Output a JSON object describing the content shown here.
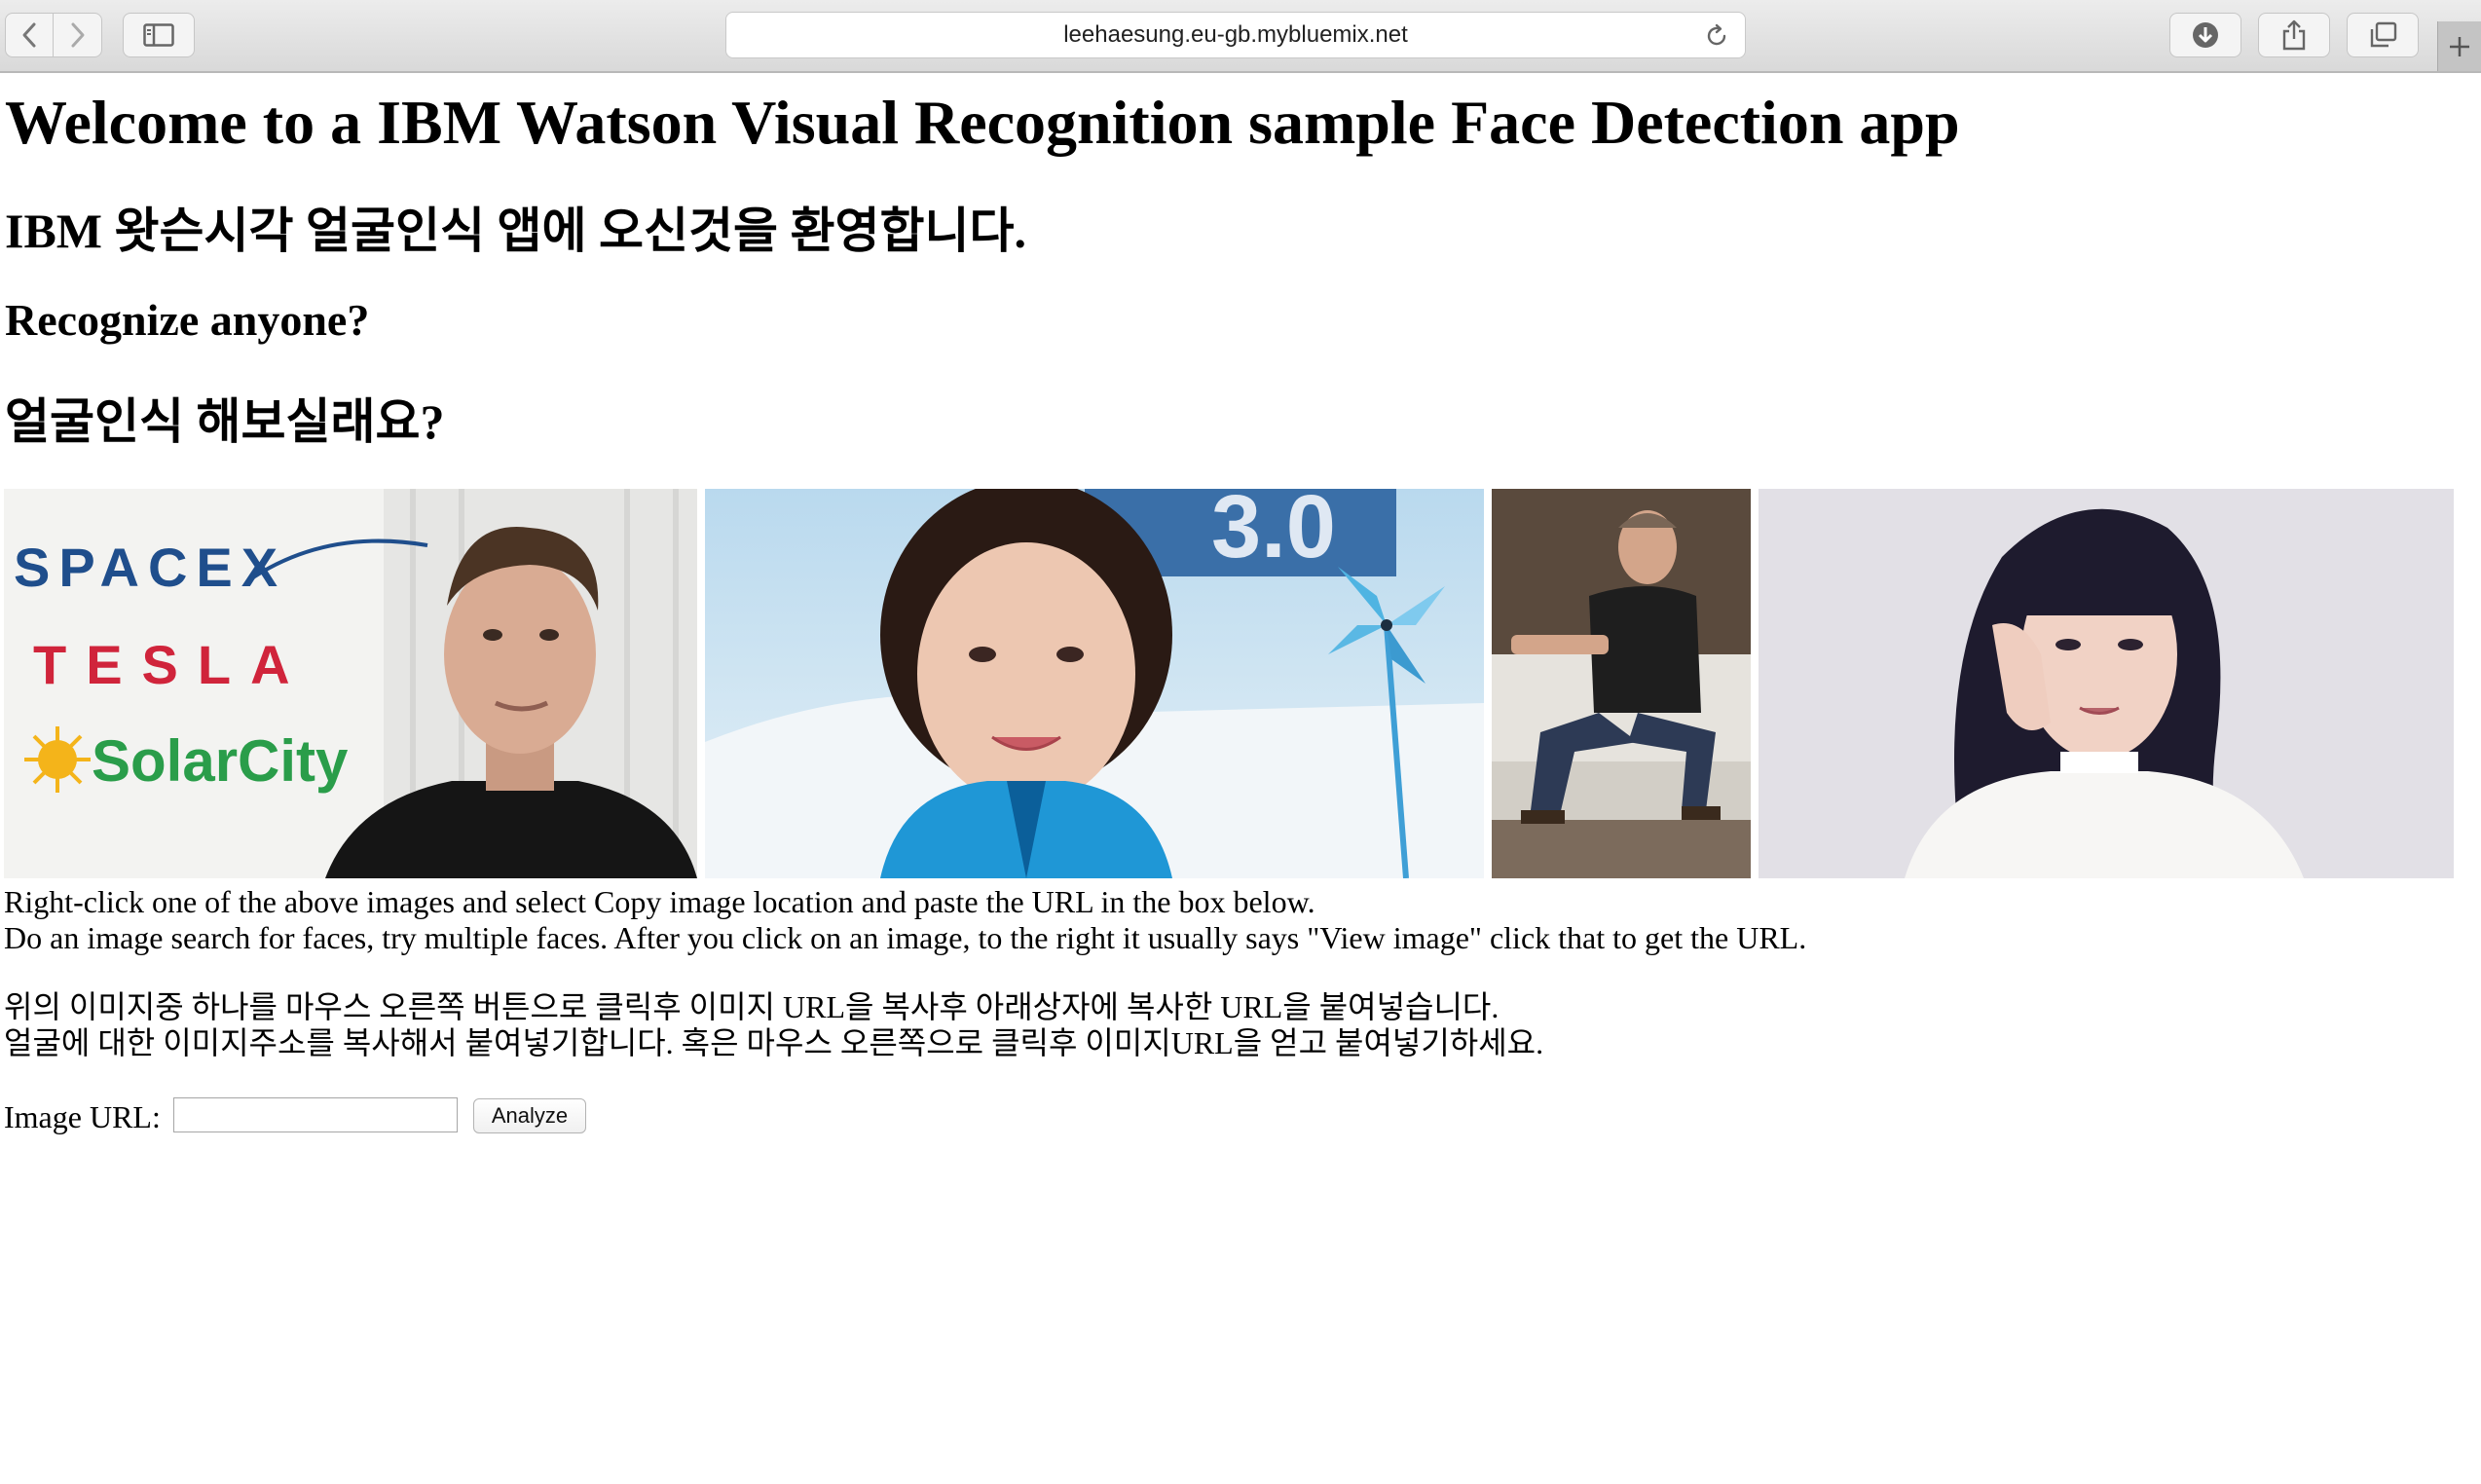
{
  "browser": {
    "url": "leehaesung.eu-gb.mybluemix.net",
    "icons": {
      "back": "chevron-left-icon",
      "forward": "chevron-right-icon",
      "sidebar": "sidebar-icon",
      "reload": "reload-icon",
      "downloads": "download-icon",
      "share": "share-icon",
      "tabs": "tabs-overview-icon",
      "new_tab": "plus-icon"
    }
  },
  "page": {
    "title": "Welcome to a IBM Watson Visual Recognition sample Face Detection app",
    "title_ko": "IBM 왓슨시각 얼굴인식 앱에 오신것을 환영합니다.",
    "prompt": "Recognize anyone?",
    "prompt_ko": "얼굴인식 해보실래요?",
    "images": [
      {
        "name": "elon-musk-photo",
        "logos": [
          "SPACEX",
          "TESLA",
          "SolarCity"
        ]
      },
      {
        "name": "skater-photo",
        "sign_text": "3.0"
      },
      {
        "name": "linus-photo"
      },
      {
        "name": "singer-photo"
      }
    ],
    "instructions": {
      "line1": "Right-click one of the above images and select Copy image location and paste the URL in the box below.",
      "line2": "Do an image search for faces, try multiple faces. After you click on an image, to the right it usually says \"View image\" click that to get the URL.",
      "line3": "위의 이미지중 하나를 마우스 오른쪽 버튼으로 클릭후 이미지 URL을 복사후 아래상자에 복사한 URL을 붙여넣습니다.",
      "line4": "얼굴에 대한 이미지주소를 복사해서 붙여넣기합니다. 혹은 마우스 오른쪽으로 클릭후 이미지URL을 얻고 붙여넣기하세요."
    },
    "form": {
      "label": "Image URL:",
      "input_value": "",
      "button": "Analyze"
    }
  }
}
